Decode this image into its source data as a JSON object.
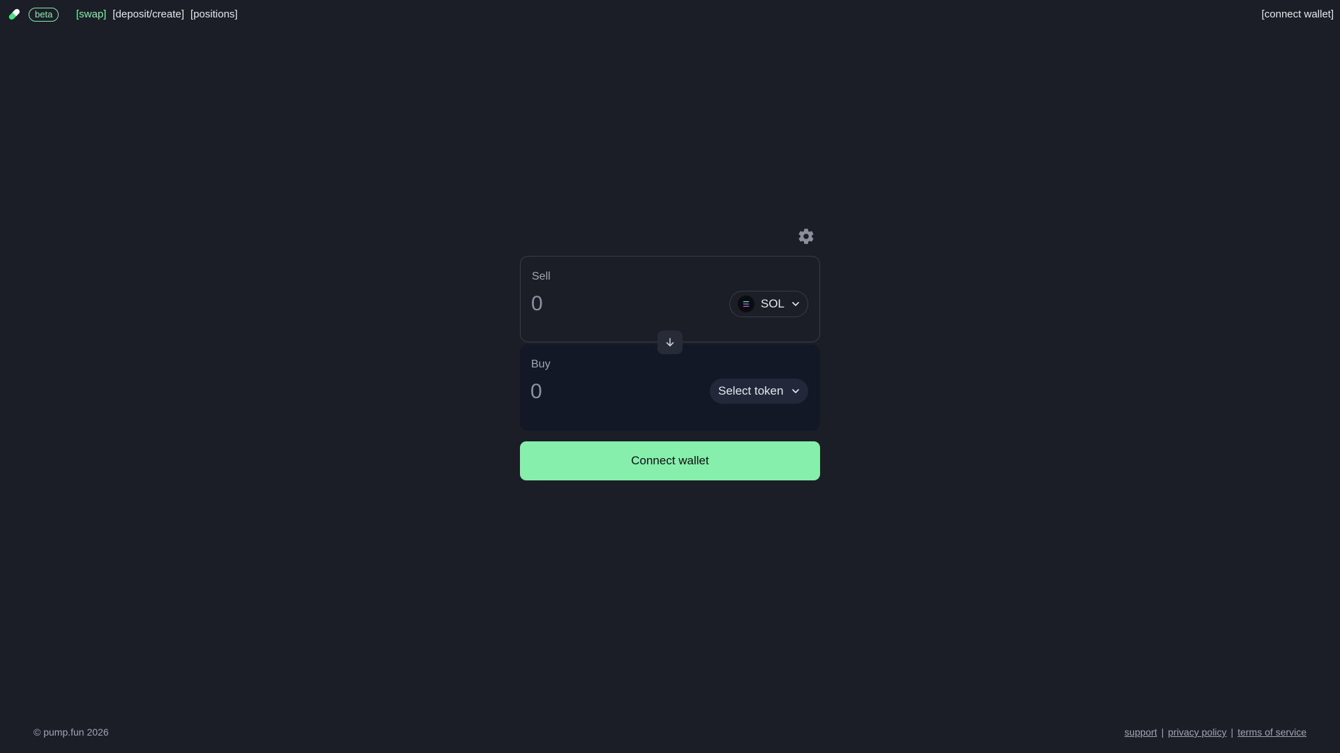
{
  "header": {
    "logo_icon": "pill-icon",
    "beta_label": "beta",
    "nav": [
      {
        "label": "[swap]",
        "active": true
      },
      {
        "label": "[deposit/create]",
        "active": false
      },
      {
        "label": "[positions]",
        "active": false
      }
    ],
    "connect_label": "[connect wallet]"
  },
  "swap": {
    "settings_icon": "gear-icon",
    "sell": {
      "label": "Sell",
      "placeholder": "0",
      "token": "SOL"
    },
    "switch_icon": "arrow-down-icon",
    "buy": {
      "label": "Buy",
      "placeholder": "0",
      "token": "Select token"
    },
    "connect_button": "Connect wallet"
  },
  "footer": {
    "copyright": "© pump.fun 2026",
    "links": [
      "support",
      "privacy policy",
      "terms of service"
    ],
    "separator": "|"
  },
  "colors": {
    "background": "#1b1d27",
    "accent": "#86efac",
    "buy_card": "#131826"
  }
}
